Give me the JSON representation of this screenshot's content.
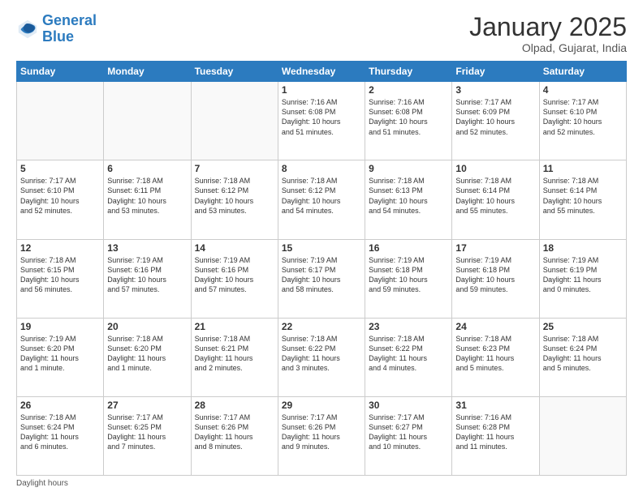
{
  "logo": {
    "line1": "General",
    "line2": "Blue"
  },
  "title": "January 2025",
  "subtitle": "Olpad, Gujarat, India",
  "days_of_week": [
    "Sunday",
    "Monday",
    "Tuesday",
    "Wednesday",
    "Thursday",
    "Friday",
    "Saturday"
  ],
  "footer": "Daylight hours",
  "weeks": [
    [
      {
        "day": "",
        "info": ""
      },
      {
        "day": "",
        "info": ""
      },
      {
        "day": "",
        "info": ""
      },
      {
        "day": "1",
        "info": "Sunrise: 7:16 AM\nSunset: 6:08 PM\nDaylight: 10 hours\nand 51 minutes."
      },
      {
        "day": "2",
        "info": "Sunrise: 7:16 AM\nSunset: 6:08 PM\nDaylight: 10 hours\nand 51 minutes."
      },
      {
        "day": "3",
        "info": "Sunrise: 7:17 AM\nSunset: 6:09 PM\nDaylight: 10 hours\nand 52 minutes."
      },
      {
        "day": "4",
        "info": "Sunrise: 7:17 AM\nSunset: 6:10 PM\nDaylight: 10 hours\nand 52 minutes."
      }
    ],
    [
      {
        "day": "5",
        "info": "Sunrise: 7:17 AM\nSunset: 6:10 PM\nDaylight: 10 hours\nand 52 minutes."
      },
      {
        "day": "6",
        "info": "Sunrise: 7:18 AM\nSunset: 6:11 PM\nDaylight: 10 hours\nand 53 minutes."
      },
      {
        "day": "7",
        "info": "Sunrise: 7:18 AM\nSunset: 6:12 PM\nDaylight: 10 hours\nand 53 minutes."
      },
      {
        "day": "8",
        "info": "Sunrise: 7:18 AM\nSunset: 6:12 PM\nDaylight: 10 hours\nand 54 minutes."
      },
      {
        "day": "9",
        "info": "Sunrise: 7:18 AM\nSunset: 6:13 PM\nDaylight: 10 hours\nand 54 minutes."
      },
      {
        "day": "10",
        "info": "Sunrise: 7:18 AM\nSunset: 6:14 PM\nDaylight: 10 hours\nand 55 minutes."
      },
      {
        "day": "11",
        "info": "Sunrise: 7:18 AM\nSunset: 6:14 PM\nDaylight: 10 hours\nand 55 minutes."
      }
    ],
    [
      {
        "day": "12",
        "info": "Sunrise: 7:18 AM\nSunset: 6:15 PM\nDaylight: 10 hours\nand 56 minutes."
      },
      {
        "day": "13",
        "info": "Sunrise: 7:19 AM\nSunset: 6:16 PM\nDaylight: 10 hours\nand 57 minutes."
      },
      {
        "day": "14",
        "info": "Sunrise: 7:19 AM\nSunset: 6:16 PM\nDaylight: 10 hours\nand 57 minutes."
      },
      {
        "day": "15",
        "info": "Sunrise: 7:19 AM\nSunset: 6:17 PM\nDaylight: 10 hours\nand 58 minutes."
      },
      {
        "day": "16",
        "info": "Sunrise: 7:19 AM\nSunset: 6:18 PM\nDaylight: 10 hours\nand 59 minutes."
      },
      {
        "day": "17",
        "info": "Sunrise: 7:19 AM\nSunset: 6:18 PM\nDaylight: 10 hours\nand 59 minutes."
      },
      {
        "day": "18",
        "info": "Sunrise: 7:19 AM\nSunset: 6:19 PM\nDaylight: 11 hours\nand 0 minutes."
      }
    ],
    [
      {
        "day": "19",
        "info": "Sunrise: 7:19 AM\nSunset: 6:20 PM\nDaylight: 11 hours\nand 1 minute."
      },
      {
        "day": "20",
        "info": "Sunrise: 7:18 AM\nSunset: 6:20 PM\nDaylight: 11 hours\nand 1 minute."
      },
      {
        "day": "21",
        "info": "Sunrise: 7:18 AM\nSunset: 6:21 PM\nDaylight: 11 hours\nand 2 minutes."
      },
      {
        "day": "22",
        "info": "Sunrise: 7:18 AM\nSunset: 6:22 PM\nDaylight: 11 hours\nand 3 minutes."
      },
      {
        "day": "23",
        "info": "Sunrise: 7:18 AM\nSunset: 6:22 PM\nDaylight: 11 hours\nand 4 minutes."
      },
      {
        "day": "24",
        "info": "Sunrise: 7:18 AM\nSunset: 6:23 PM\nDaylight: 11 hours\nand 5 minutes."
      },
      {
        "day": "25",
        "info": "Sunrise: 7:18 AM\nSunset: 6:24 PM\nDaylight: 11 hours\nand 5 minutes."
      }
    ],
    [
      {
        "day": "26",
        "info": "Sunrise: 7:18 AM\nSunset: 6:24 PM\nDaylight: 11 hours\nand 6 minutes."
      },
      {
        "day": "27",
        "info": "Sunrise: 7:17 AM\nSunset: 6:25 PM\nDaylight: 11 hours\nand 7 minutes."
      },
      {
        "day": "28",
        "info": "Sunrise: 7:17 AM\nSunset: 6:26 PM\nDaylight: 11 hours\nand 8 minutes."
      },
      {
        "day": "29",
        "info": "Sunrise: 7:17 AM\nSunset: 6:26 PM\nDaylight: 11 hours\nand 9 minutes."
      },
      {
        "day": "30",
        "info": "Sunrise: 7:17 AM\nSunset: 6:27 PM\nDaylight: 11 hours\nand 10 minutes."
      },
      {
        "day": "31",
        "info": "Sunrise: 7:16 AM\nSunset: 6:28 PM\nDaylight: 11 hours\nand 11 minutes."
      },
      {
        "day": "",
        "info": ""
      }
    ]
  ]
}
